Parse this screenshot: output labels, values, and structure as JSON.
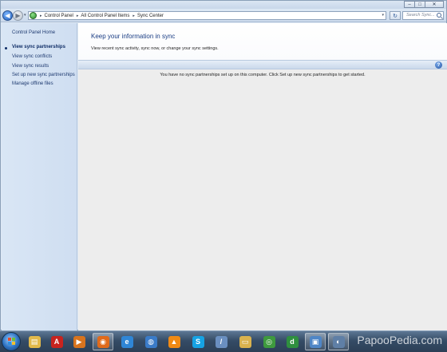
{
  "window": {
    "controls": {
      "minimize": "–",
      "maximize": "□",
      "close": "✕"
    }
  },
  "navbar": {
    "back_glyph": "◀",
    "forward_glyph": "▶",
    "dropdown_glyph": "▾",
    "breadcrumbs": [
      "Control Panel",
      "All Control Panel Items",
      "Sync Center"
    ],
    "separator": "▸",
    "refresh_glyph": "↻",
    "search_placeholder": "Search Sync..."
  },
  "sidebar": {
    "home_label": "Control Panel Home",
    "tasks": [
      {
        "label": "View sync partnerships",
        "active": true
      },
      {
        "label": "View sync conflicts",
        "active": false
      },
      {
        "label": "View sync results",
        "active": false
      },
      {
        "label": "Set up new sync partnerships",
        "active": false
      },
      {
        "label": "Manage offline files",
        "active": false
      }
    ]
  },
  "main": {
    "title": "Keep your information in sync",
    "subtitle": "View recent sync activity, sync now, or change your sync settings.",
    "help_glyph": "?",
    "empty_message": "You have no sync partnerships set up on this computer. Click Set up new sync partnerships to get started."
  },
  "taskbar": {
    "apps": [
      {
        "name": "explorer-icon",
        "glyph": "▤",
        "color": "#e2b94a"
      },
      {
        "name": "acrobat-icon",
        "glyph": "A",
        "color": "#c8231e"
      },
      {
        "name": "media-player-icon",
        "glyph": "▶",
        "color": "#d8741e"
      },
      {
        "name": "firefox-icon",
        "glyph": "◉",
        "color": "#e06a1b"
      },
      {
        "name": "internet-explorer-icon",
        "glyph": "e",
        "color": "#2f86d6"
      },
      {
        "name": "network-icon",
        "glyph": "◍",
        "color": "#3a7bc8"
      },
      {
        "name": "vlc-icon",
        "glyph": "▲",
        "color": "#f08a14"
      },
      {
        "name": "skype-icon",
        "glyph": "S",
        "color": "#16a3e4"
      },
      {
        "name": "pen-tool-icon",
        "glyph": "/",
        "color": "#6a8fc0"
      },
      {
        "name": "folder-icon",
        "glyph": "▭",
        "color": "#d9b24e"
      },
      {
        "name": "chrome-icon",
        "glyph": "◎",
        "color": "#3e9a3e"
      },
      {
        "name": "dreamweaver-icon",
        "glyph": "d",
        "color": "#2f8f3f"
      },
      {
        "name": "remote-desktop-icon",
        "glyph": "▣",
        "color": "#4f86c6"
      },
      {
        "name": "sync-center-icon",
        "glyph": "◐",
        "color": "#5f7fa6"
      }
    ],
    "watermark": "PapooPedia.com"
  }
}
